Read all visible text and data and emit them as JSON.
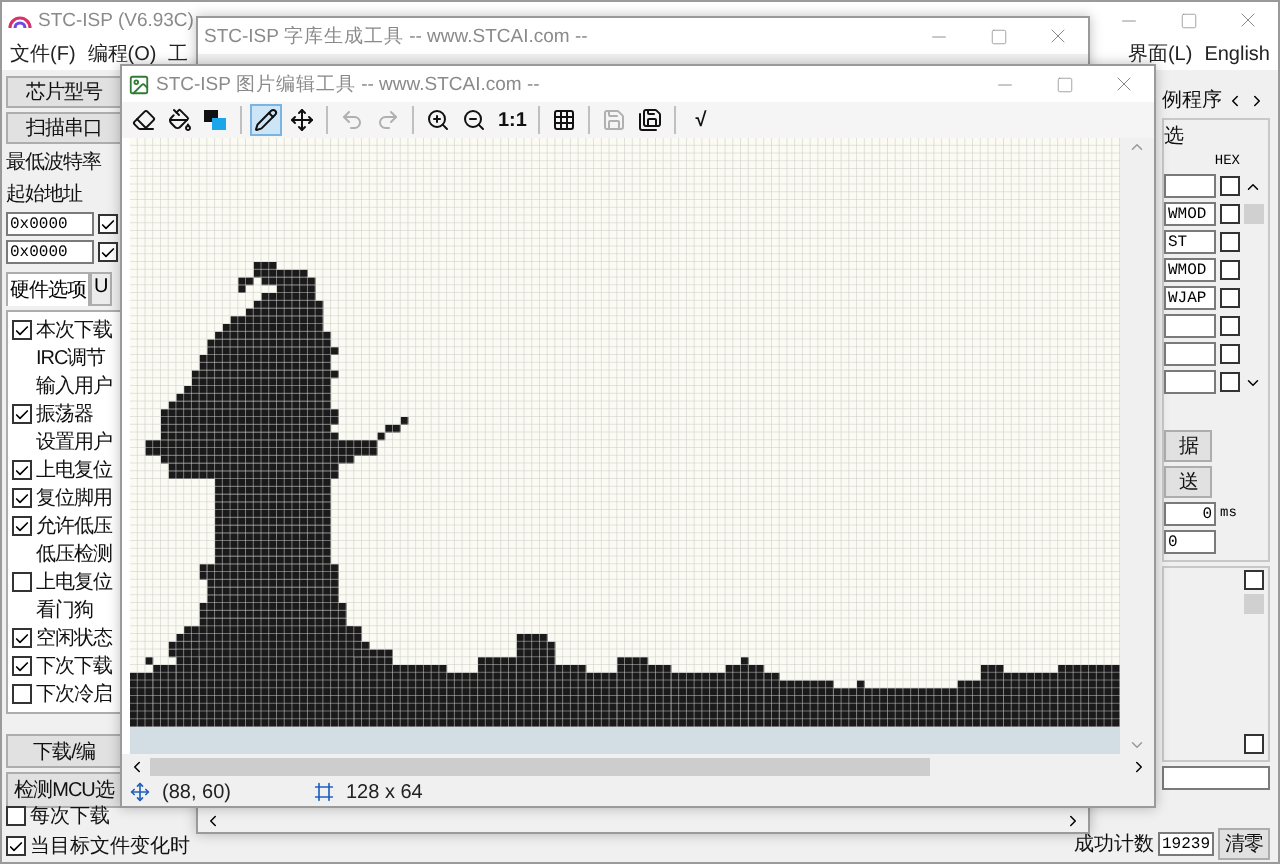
{
  "main_window": {
    "title": "STC-ISP (V6.93C)",
    "menu_left": [
      "文件(F)",
      "编程(O)",
      "工"
    ],
    "menu_right": [
      "界面(L)",
      "English"
    ],
    "chip_button": "芯片型号",
    "scan_button": "扫描串口",
    "baud_label": "最低波特率",
    "address_label": "起始地址",
    "address_fields": [
      {
        "value": "0x0000",
        "checked": true
      },
      {
        "value": "0x0000",
        "checked": true
      }
    ],
    "tabs": [
      {
        "label": "硬件选项",
        "selected": true
      },
      {
        "label": "U",
        "selected": false
      }
    ],
    "options": [
      {
        "kind": "checkbox",
        "label": "本次下载",
        "checked": true
      },
      {
        "kind": "note",
        "label": "IRC调节"
      },
      {
        "kind": "note",
        "label": "输入用户"
      },
      {
        "kind": "checkbox",
        "label": "振荡器",
        "checked": true
      },
      {
        "kind": "note",
        "label": "设置用户"
      },
      {
        "kind": "checkbox",
        "label": "上电复位",
        "checked": true
      },
      {
        "kind": "checkbox",
        "label": "复位脚用",
        "checked": true
      },
      {
        "kind": "checkbox",
        "label": "允许低压",
        "checked": true
      },
      {
        "kind": "note",
        "label": "低压检测"
      },
      {
        "kind": "checkbox",
        "label": "上电复位",
        "checked": false
      },
      {
        "kind": "note",
        "label": "看门狗"
      },
      {
        "kind": "checkbox",
        "label": "空闲状态",
        "checked": true
      },
      {
        "kind": "checkbox",
        "label": "下次下载",
        "checked": true
      },
      {
        "kind": "checkbox",
        "label": "下次冷启",
        "checked": false
      }
    ],
    "action_buttons": [
      "下载/编",
      "检测MCU选"
    ],
    "footer_checks": [
      {
        "label": "每次下载",
        "checked": false
      },
      {
        "label": "当目标文件变化时",
        "checked": true
      }
    ],
    "right_panel": {
      "tab_label": "例程序",
      "group_label": "选",
      "hex_label": "HEX",
      "rows": [
        {
          "checked": false
        },
        {
          "value": "WMOD",
          "checked": false
        },
        {
          "value": "ST",
          "checked": false
        },
        {
          "value": "WMOD",
          "checked": false
        },
        {
          "value": "WJAP",
          "checked": false
        },
        {
          "checked": false
        },
        {
          "checked": false
        },
        {
          "checked": false
        }
      ],
      "data_buttons": [
        "据",
        "送"
      ],
      "delay_value": "0",
      "delay_unit": "ms",
      "count_value": "0",
      "flags": [
        {
          "checked": false
        },
        {
          "checked": false
        }
      ]
    },
    "success_label": "成功计数",
    "success_count": "19239",
    "clear_button": "清零"
  },
  "font_window": {
    "title": "STC-ISP 字库生成工具 -- www.STCAI.com --"
  },
  "image_editor": {
    "title": "STC-ISP 图片编辑工具 -- www.STCAI.com --",
    "toolbar": [
      [
        {
          "kind": "eraser",
          "selected": false,
          "disabled": false
        },
        {
          "kind": "fill",
          "selected": false,
          "disabled": false
        },
        {
          "kind": "colors",
          "selected": false,
          "disabled": false
        }
      ],
      [
        {
          "kind": "pencil",
          "selected": true,
          "disabled": false
        },
        {
          "kind": "move",
          "selected": false,
          "disabled": false
        }
      ],
      [
        {
          "kind": "undo",
          "selected": false,
          "disabled": true
        },
        {
          "kind": "redo",
          "selected": false,
          "disabled": true
        }
      ],
      [
        {
          "kind": "zoom_in",
          "selected": false,
          "disabled": false
        },
        {
          "kind": "zoom_out",
          "selected": false,
          "disabled": false
        },
        {
          "kind": "text",
          "label": "1:1",
          "selected": false,
          "disabled": false
        }
      ],
      [
        {
          "kind": "grid",
          "selected": false,
          "disabled": false
        }
      ],
      [
        {
          "kind": "save",
          "selected": false,
          "disabled": true
        },
        {
          "kind": "export",
          "selected": false,
          "disabled": false
        }
      ],
      [
        {
          "kind": "text",
          "label": "√",
          "selected": false,
          "disabled": false
        }
      ]
    ],
    "status": {
      "cursor": "(88, 60)",
      "size": "128 x 64"
    }
  }
}
